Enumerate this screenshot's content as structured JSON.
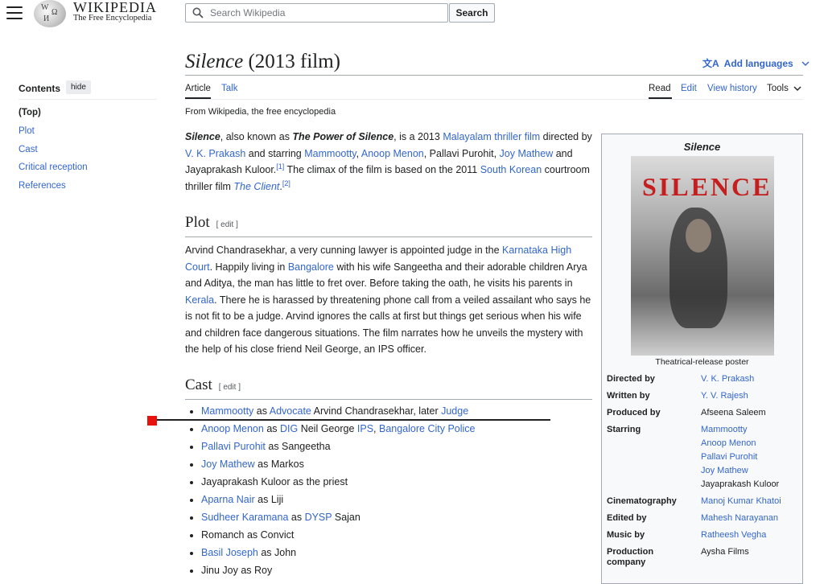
{
  "header": {
    "wordmark": "WIKIPEDIA",
    "tagline": "The Free Encyclopedia",
    "search_placeholder": "Search Wikipedia",
    "search_button": "Search"
  },
  "toc": {
    "title": "Contents",
    "hide": "hide",
    "items": [
      "(Top)",
      "Plot",
      "Cast",
      "Critical reception",
      "References"
    ]
  },
  "article": {
    "title_italic": "Silence",
    "title_rest": " (2013 film)",
    "add_languages": "Add languages",
    "tabs_left": [
      "Article",
      "Talk"
    ],
    "tabs_right": [
      "Read",
      "Edit",
      "View history",
      "Tools"
    ],
    "from": "From Wikipedia, the free encyclopedia",
    "intro": {
      "t1": "Silence",
      "t2": ", also known as ",
      "t3": "The Power of Silence",
      "t4": ", is a 2013 ",
      "l1": "Malayalam",
      "t5": " ",
      "l2": "thriller film",
      "t6": " directed by ",
      "l3": "V. K. Prakash",
      "t7": " and starring ",
      "l4": "Mammootty",
      "t8": ", ",
      "l5": "Anoop Menon",
      "t9": ", Pallavi Purohit, ",
      "l6": "Joy Mathew",
      "t10": " and Jayaprakash Kuloor.",
      "ref1": "[1]",
      "t11": " The climax of the film is based on the 2011 ",
      "l7": "South Korean",
      "t12": " courtroom thriller film ",
      "l8": "The Client",
      "t13": ".",
      "ref2": "[2]"
    },
    "plot_heading": "Plot",
    "cast_heading": "Cast",
    "edit_label": "[ edit ]",
    "plot": {
      "t1": "Arvind Chandrasekhar, a very cunning lawyer is appointed judge in the ",
      "l1": "Karnataka High Court",
      "t2": ". Happily living in ",
      "l2": "Bangalore",
      "t3": " with his wife Sangeetha and their adorable children Arya and Aditya, the man has little to fret over. Before taking the oath, he visits his parents in ",
      "l3": "Kerala",
      "t4": ". There he is harassed by threatening phone call from a veiled assailant who says he is not fit to be a judge. Arvind ignores the calls at first but things get serious when his wife and children face dangerous situations. The film narrates how he unveils the mystery with the help of his close friend Neil George, an IPS officer."
    },
    "cast": [
      {
        "a": "Mammootty",
        "b": " as ",
        "c": "Advocate",
        "d": " Arvind Chandrasekhar, later ",
        "e": "Judge"
      },
      {
        "a": "Anoop Menon",
        "b": " as ",
        "c": "DIG",
        "d": " Neil George ",
        "e": "IPS",
        "f": ", ",
        "g": "Bangalore City Police"
      },
      {
        "a": "Pallavi Purohit",
        "b": " as Sangeetha"
      },
      {
        "a": "Joy Mathew",
        "b": " as Markos"
      },
      {
        "p": "Jayaprakash Kuloor as the priest"
      },
      {
        "a": "Aparna Nair",
        "b": " as Liji"
      },
      {
        "a": "Sudheer Karamana",
        "b": " as ",
        "c": "DYSP",
        "d": " Sajan"
      },
      {
        "p": "Romanch as Convict"
      },
      {
        "a": "Basil Joseph",
        "b": " as John"
      },
      {
        "p": "Jinu Joy as Roy"
      }
    ]
  },
  "infobox": {
    "title": "Silence",
    "poster_text": "SILENCE",
    "caption": "Theatrical-release poster",
    "rows": [
      {
        "label": "Directed by",
        "values": [
          "V. K. Prakash"
        ],
        "links": [
          true
        ]
      },
      {
        "label": "Written by",
        "values": [
          "Y. V. Rajesh"
        ],
        "links": [
          true
        ]
      },
      {
        "label": "Produced by",
        "values": [
          "Afseena Saleem"
        ],
        "links": [
          false
        ]
      },
      {
        "label": "Starring",
        "values": [
          "Mammootty",
          "Anoop Menon",
          "Pallavi Purohit",
          "Joy Mathew",
          "Jayaprakash Kuloor"
        ],
        "links": [
          true,
          true,
          true,
          true,
          false
        ]
      },
      {
        "label": "Cinematography",
        "values": [
          "Manoj Kumar Khatoi"
        ],
        "links": [
          true
        ]
      },
      {
        "label": "Edited by",
        "values": [
          "Mahesh Narayanan"
        ],
        "links": [
          true
        ]
      },
      {
        "label": "Music by",
        "values": [
          "Ratheesh Vegha"
        ],
        "links": [
          true
        ]
      },
      {
        "label": "Production company",
        "values": [
          "Aysha Films"
        ],
        "links": [
          false
        ]
      }
    ]
  },
  "colors": {
    "link": "#3366cc",
    "marker": "#e8120c"
  }
}
